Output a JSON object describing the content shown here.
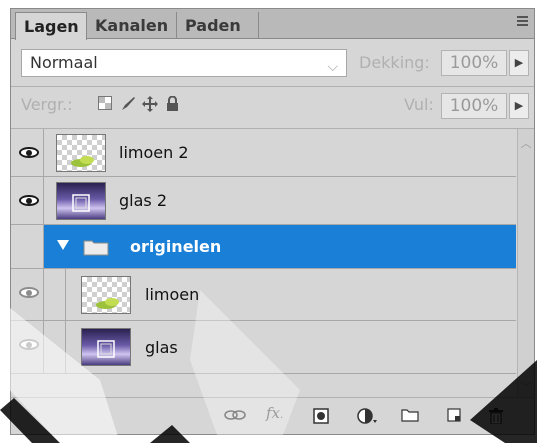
{
  "tabs": [
    "Lagen",
    "Kanalen",
    "Paden"
  ],
  "blend": {
    "mode": "Normaal",
    "opacity_label": "Dekking:",
    "opacity_value": "100%",
    "fill_label": "Vul:",
    "fill_value": "100%",
    "lock_label": "Vergr.:"
  },
  "layers": [
    {
      "name": "limoen 2",
      "visible": true
    },
    {
      "name": "glas 2",
      "visible": true
    },
    {
      "name": "originelen",
      "visible": false,
      "is_group": true,
      "expanded": true,
      "selected": true
    },
    {
      "name": "limoen",
      "visible": true,
      "in_group": true
    },
    {
      "name": "glas",
      "visible": true,
      "in_group": true
    }
  ],
  "toolbar_icons": [
    "link-icon",
    "fx-icon",
    "mask-icon",
    "adjustment-icon",
    "folder-icon",
    "new-layer-icon",
    "trash-icon"
  ],
  "colors": {
    "selection": "#1a7fd6",
    "panel_bg": "#d6d6d6"
  }
}
